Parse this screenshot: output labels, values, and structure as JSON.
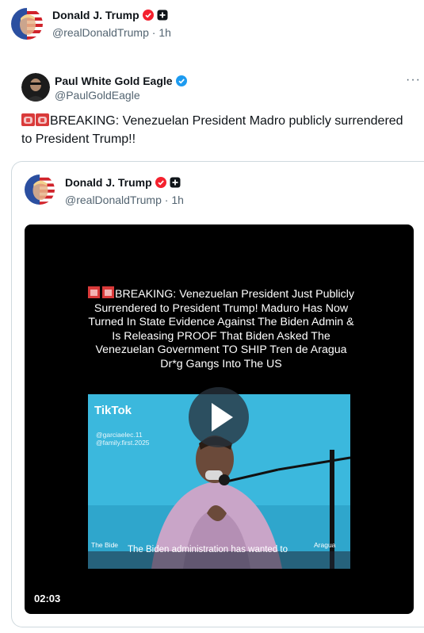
{
  "outer_post": {
    "author_name": "Donald J. Trump",
    "handle": "@realDonaldTrump",
    "time": "1h",
    "separator": "·"
  },
  "post": {
    "author_name": "Paul White Gold Eagle",
    "handle": "@PaulGoldEagle",
    "text": "BREAKING: Venezuelan President Madro publicly surrendered to President Trump!!",
    "more_label": "···"
  },
  "quote": {
    "author_name": "Donald J. Trump",
    "handle": "@realDonaldTrump",
    "time": "1h",
    "separator": "·"
  },
  "video": {
    "caption": "BREAKING: Venezuelan President Just Publicly Surrendered to President Trump! Maduro Has Now Turned In State Evidence Against The Biden Admin & Is Releasing PROOF That Biden Asked The Venezuelan Government TO SHIP Tren de Aragua Dr*g Gangs Into The US",
    "tiktok_logo": "TikTok",
    "tiktok_user_1": "@garciaelec.11",
    "tiktok_user_2": "@family.first.2025",
    "subtitle": "The Biden administration has wanted to",
    "subtitle_left": "The Bide",
    "subtitle_right": "Aragua",
    "duration": "02:03"
  },
  "colors": {
    "verified_blue": "#1d9bf0",
    "gold_badge": "#f4212e",
    "handle_gray": "#536471",
    "border": "#cfd9de"
  },
  "icons": {
    "verified": "verified-badge-icon",
    "affiliate": "affiliate-badge-icon",
    "siren": "police-light-icon",
    "play": "play-icon",
    "more": "more-icon"
  }
}
